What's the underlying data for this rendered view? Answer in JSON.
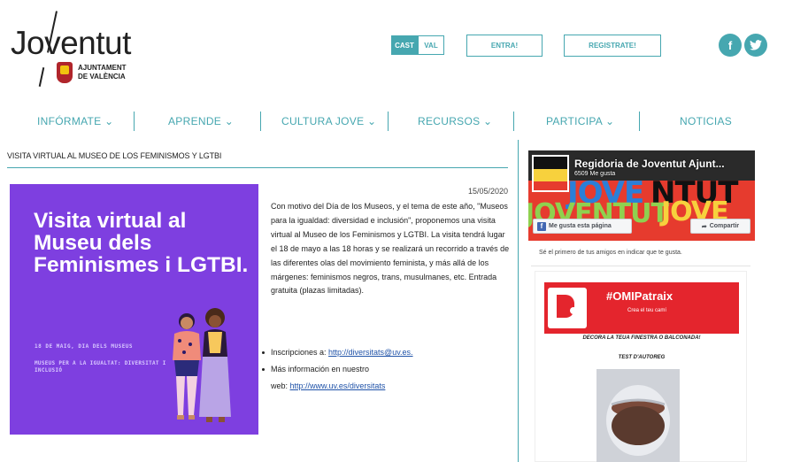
{
  "header": {
    "logo_text": "Joventut",
    "ajuntament_line1": "AJUNTAMENT",
    "ajuntament_line2": "DE VALÈNCIA",
    "lang_cast": "CAST",
    "lang_val": "VAL",
    "entra_label": "ENTRA!",
    "registrate_label": "REGISTRATE!",
    "social": [
      {
        "icon": "facebook-icon",
        "glyph": "f"
      },
      {
        "icon": "twitter-icon",
        "glyph": "🐦"
      }
    ]
  },
  "nav": {
    "items": [
      {
        "label": "INFÓRMATE ⌄"
      },
      {
        "label": "APRENDE ⌄"
      },
      {
        "label": "CULTURA JOVE ⌄"
      },
      {
        "label": "RECURSOS ⌄"
      },
      {
        "label": "PARTICIPA ⌄"
      },
      {
        "label": "NOTICIAS"
      }
    ]
  },
  "article": {
    "title": "VISITA VIRTUAL AL MUSEO DE LOS FEMINISMOS Y LGTBI",
    "date": "15/05/2020",
    "body": "Con motivo del Día de los Museos, y el tema de este año, \"Museos para la igualdad: diversidad e inclusión\", proponemos una visita virtual al Museo de los Feminismos y LGTBI. La visita tendrá lugar el 18 de mayo a las 18 horas y se realizará un recorrido a través de las diferentes olas del movimiento feminista, y más allá de los márgenes: feminismos negros, trans, musulmanes, etc. Entrada gratuita (plazas limitadas).",
    "bullets": {
      "inscripciones_label": "Inscripciones a: ",
      "inscripciones_link": "http://diversitats@uv.es.",
      "info_label": "Más información en nuestro",
      "web_label": "web: ",
      "web_link": "http://www.uv.es/diversitats"
    },
    "poster": {
      "title": "Visita virtual al Museu dels Feminismes i LGTBI.",
      "date_line": "18 DE MAIG, DIA DELS MUSEUS",
      "sub_line": "MUSEUS PER A LA IGUALTAT: DIVERSITAT I INCLUSIÓ",
      "bg_color": "#7e3fe0"
    }
  },
  "sidebar": {
    "fb_widget": {
      "page_name": "Regidoria de Joventut Ajunt...",
      "likes": "6509 Me gusta",
      "like_button": "Me gusta esta página",
      "share_button": "Compartir",
      "share_icon": "share-arrow-icon",
      "friends_text": "Sé el primero de tus amigos en indicar que te gusta."
    },
    "ad": {
      "hashtag": "#OMIPatraix",
      "subtitle": "Crea el teu camí",
      "decora": "DECORA LA TEUA FINESTRA O BALCONADA!",
      "test": "TEST D'AUTOREG"
    }
  },
  "colors": {
    "accent": "#46a7b0",
    "link": "#1f52a8",
    "ad_red": "#e4252d"
  }
}
